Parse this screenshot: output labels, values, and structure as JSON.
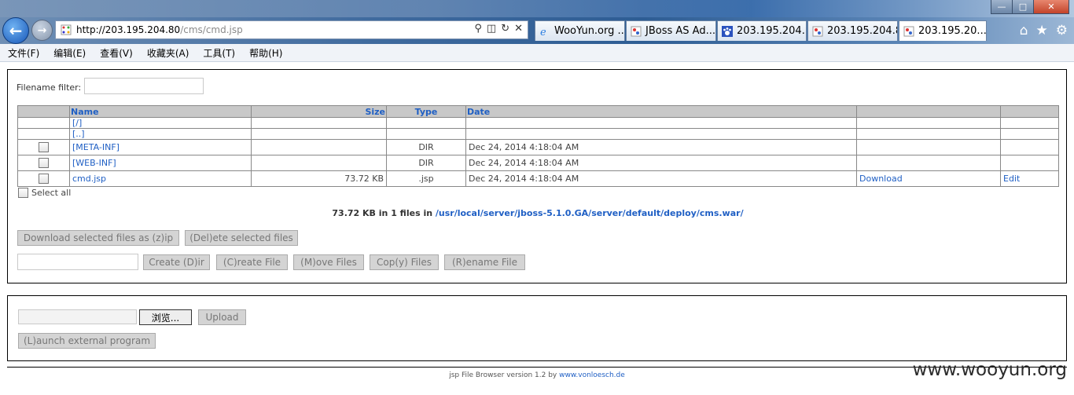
{
  "browser": {
    "url_host": "http://203.195.204.80",
    "url_path": "/cms/cmd.jsp",
    "tabs": [
      {
        "label": "WooYun.org ...",
        "active": false,
        "icon": "ie-icon"
      },
      {
        "label": "JBoss AS Ad...",
        "active": false,
        "icon": "page-icon"
      },
      {
        "label": "203.195.204....",
        "active": false,
        "icon": "paw-icon"
      },
      {
        "label": "203.195.204.80",
        "active": false,
        "icon": "page-icon"
      },
      {
        "label": "203.195.20...",
        "active": true,
        "icon": "page-icon"
      }
    ],
    "tab_close": "✕",
    "window_buttons": {
      "minimize": "—",
      "maximize": "□",
      "close": "✕"
    },
    "toolbar_icons": {
      "home": "⌂",
      "favorites": "★",
      "settings": "⚙"
    }
  },
  "menubar": {
    "items": [
      "文件(F)",
      "编辑(E)",
      "查看(V)",
      "收藏夹(A)",
      "工具(T)",
      "帮助(H)"
    ]
  },
  "filter": {
    "label": "Filename filter:",
    "value": ""
  },
  "table": {
    "headers": {
      "name": "Name",
      "size": "Size",
      "type": "Type",
      "date": "Date"
    },
    "rows": [
      {
        "name": "[/]",
        "size": "",
        "type": "",
        "date": "",
        "download": "",
        "edit": "",
        "checkbox": false
      },
      {
        "name": "[..]",
        "size": "",
        "type": "",
        "date": "",
        "download": "",
        "edit": "",
        "checkbox": false
      },
      {
        "name": "[META-INF]",
        "size": "",
        "type": "DIR",
        "date": "Dec 24, 2014 4:18:04 AM",
        "download": "",
        "edit": "",
        "checkbox": true
      },
      {
        "name": "[WEB-INF]",
        "size": "",
        "type": "DIR",
        "date": "Dec 24, 2014 4:18:04 AM",
        "download": "",
        "edit": "",
        "checkbox": true
      },
      {
        "name": "cmd.jsp",
        "size": "73.72 KB",
        "type": ".jsp",
        "date": "Dec 24, 2014 4:18:04 AM",
        "download": "Download",
        "edit": "Edit",
        "checkbox": true
      }
    ]
  },
  "select_all": "Select all",
  "summary": {
    "text": "73.72 KB in 1 files in ",
    "path": "/usr/local/server/jboss-5.1.0.GA/server/default/deploy/cms.war/"
  },
  "buttons": {
    "download_zip": "Download selected files as (z)ip",
    "delete": "(Del)ete selected files",
    "create_dir": "Create (D)ir",
    "create_file": "(C)reate File",
    "move_files": "(M)ove Files",
    "copy_files": "Cop(y) Files",
    "rename_file": "(R)ename File",
    "browse": "浏览...",
    "upload": "Upload",
    "launch": "(L)aunch external program"
  },
  "footer": {
    "text": "jsp File Browser version 1.2 by ",
    "link": "www.vonloesch.de"
  },
  "watermark": "www.wooyun.org"
}
